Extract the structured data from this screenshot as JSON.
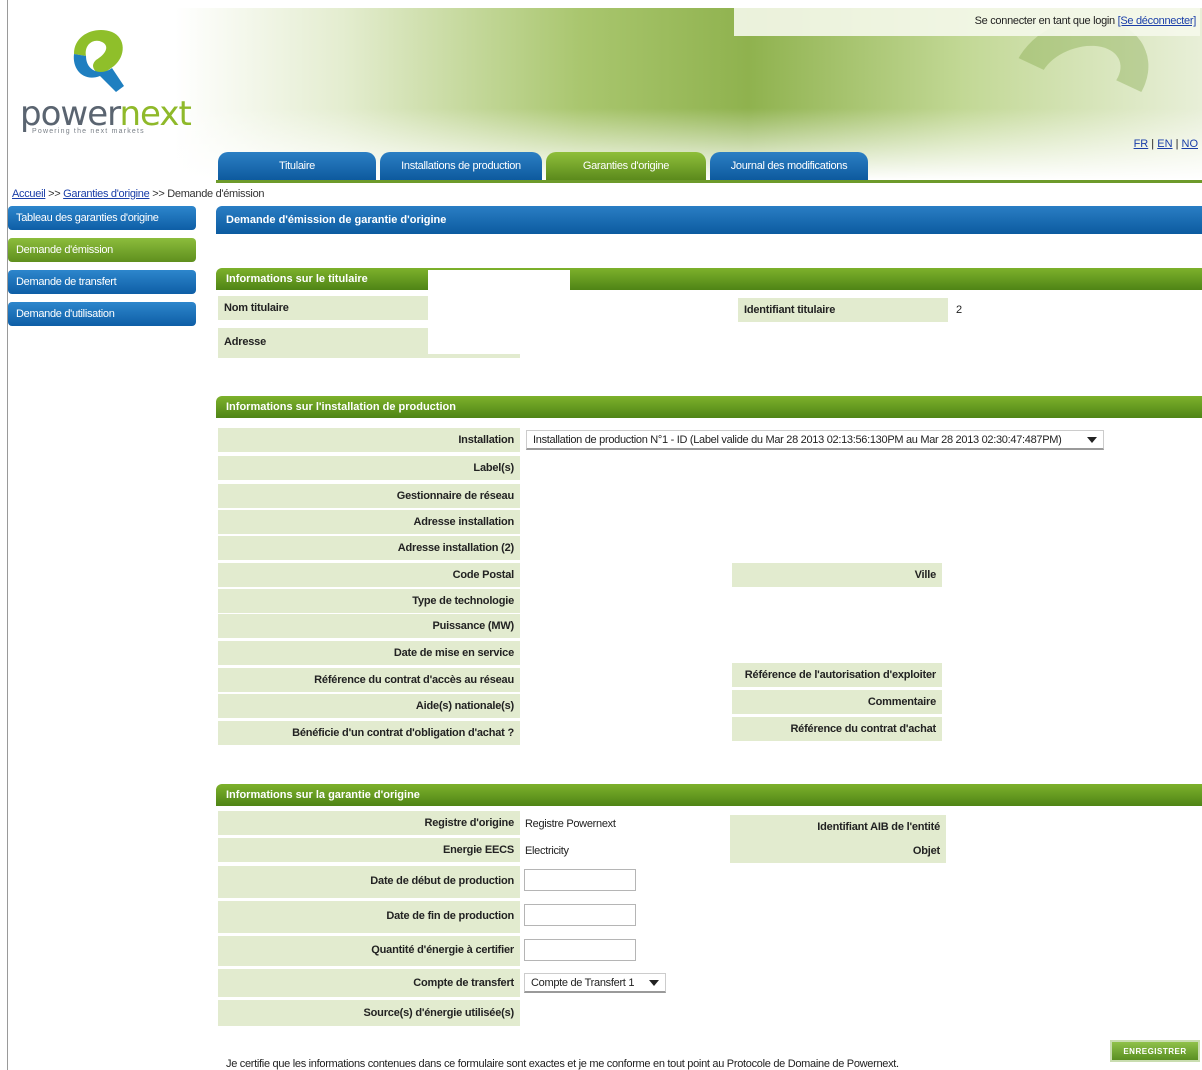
{
  "header": {
    "login_prefix": "Se connecter en tant que login",
    "logout_link": "[Se déconnecter]",
    "logo_word_a": "power",
    "logo_word_b": "next",
    "logo_tagline": "Powering the next markets",
    "lang_fr": "FR",
    "lang_en": "EN",
    "lang_no": "NO",
    "lang_sep": " | "
  },
  "tabs": [
    {
      "label": "Titulaire"
    },
    {
      "label": "Installations de production"
    },
    {
      "label": "Garanties d'origine"
    },
    {
      "label": "Journal des modifications"
    }
  ],
  "breadcrumb": {
    "home": "Accueil",
    "sep": ">>",
    "section": "Garanties d'origine",
    "current": "Demande d'émission"
  },
  "sidebar": {
    "items": [
      {
        "label": "Tableau des garanties d'origine"
      },
      {
        "label": "Demande d'émission"
      },
      {
        "label": "Demande de transfert"
      },
      {
        "label": "Demande d'utilisation"
      }
    ]
  },
  "page_title": "Demande d'émission de garantie d'origine",
  "holder": {
    "section_title": "Informations sur le titulaire",
    "name_label": "Nom titulaire",
    "address_label": "Adresse",
    "id_label": "Identifiant titulaire",
    "id_value": "2"
  },
  "installation": {
    "section_title": "Informations sur l'installation de production",
    "installation_label": "Installation",
    "installation_value": "Installation de production N°1 - ID (Label valide du Mar 28 2013 02:13:56:130PM au Mar 28 2013 02:30:47:487PM)",
    "labels_label": "Label(s)",
    "grid_manager_label": "Gestionnaire de réseau",
    "address_label": "Adresse installation",
    "address2_label": "Adresse installation (2)",
    "postal_label": "Code Postal",
    "city_label": "Ville",
    "tech_label": "Type de technologie",
    "power_label": "Puissance (MW)",
    "commission_label": "Date de mise en service",
    "grid_contract_label": "Référence du contrat d'accès au réseau",
    "auth_label": "Référence de l'autorisation d'exploiter",
    "aid_label": "Aide(s) nationale(s)",
    "comment_label": "Commentaire",
    "obligation_label": "Bénéficie d'un contrat d'obligation d'achat ?",
    "purchase_ref_label": "Référence du contrat d'achat"
  },
  "guarantee": {
    "section_title": "Informations sur la garantie d'origine",
    "registry_label": "Registre d'origine",
    "registry_value": "Registre Powernext",
    "aib_label": "Identifiant AIB de l'entité",
    "eecs_label": "Energie EECS",
    "eecs_value": "Electricity",
    "object_label": "Objet",
    "start_label": "Date de début de production",
    "end_label": "Date de fin de production",
    "quantity_label": "Quantité d'énergie à certifier",
    "transfer_label": "Compte de transfert",
    "transfer_value": "Compte de Transfert 1",
    "sources_label": "Source(s) d'énergie utilisée(s)"
  },
  "footer": {
    "save_label": "ENREGISTRER",
    "certify_text": "Je certifie que les informations contenues dans ce formulaire sont exactes et je me conforme en tout point au Protocole de Domaine de Powernext."
  },
  "colors": {
    "blue": "#0e5ea6",
    "green": "#5b8a1c",
    "cell_bg": "#e2ebcf"
  }
}
